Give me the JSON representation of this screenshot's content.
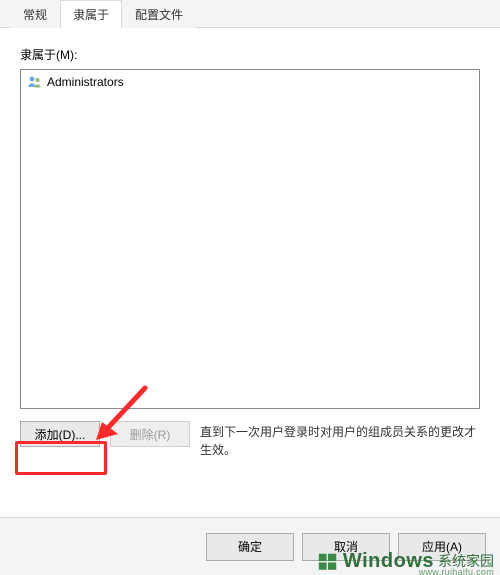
{
  "tabs": {
    "general": "常规",
    "memberof": "隶属于",
    "profile": "配置文件"
  },
  "memberof": {
    "label": "隶属于(M):",
    "items": [
      {
        "name": "Administrators"
      }
    ],
    "add_label": "添加(D)...",
    "remove_label": "删除(R)",
    "hint": "直到下一次用户登录时对用户的组成员关系的更改才生效。"
  },
  "dialog_buttons": {
    "ok": "确定",
    "cancel": "取消",
    "apply": "应用(A)"
  },
  "annotation": {
    "highlight_target": "add-button",
    "arrow_color": "#ff2a2a"
  },
  "watermark": {
    "brand_main": "Windows",
    "brand_sub": "系统家园",
    "url": "www.ruihaifu.com",
    "accent": "#2f6f3a"
  }
}
